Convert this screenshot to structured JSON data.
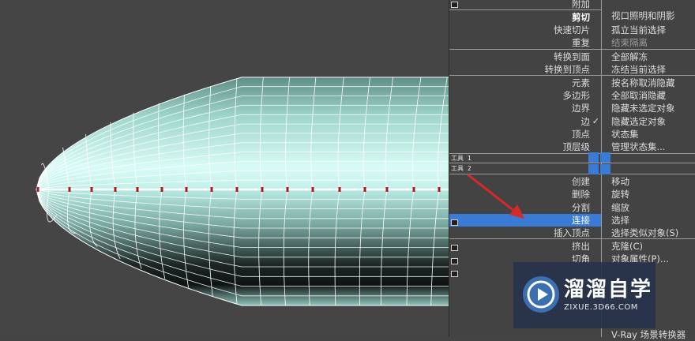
{
  "left_menu": {
    "items": [
      {
        "label": "附加",
        "style": "normal"
      },
      {
        "label": "剪切",
        "style": "bold"
      },
      {
        "label": "快速切片",
        "style": "normal"
      },
      {
        "label": "重复",
        "style": "normal"
      },
      {
        "label": "转换到面",
        "style": "normal"
      },
      {
        "label": "转换到顶点",
        "style": "normal"
      },
      {
        "label": "元素",
        "style": "normal"
      },
      {
        "label": "多边形",
        "style": "normal"
      },
      {
        "label": "边界",
        "style": "normal"
      },
      {
        "label": "边",
        "style": "normal",
        "checked": true
      },
      {
        "label": "顶点",
        "style": "normal"
      },
      {
        "label": "顶层级",
        "style": "normal"
      },
      {
        "label": "创建",
        "style": "normal"
      },
      {
        "label": "删除",
        "style": "normal"
      },
      {
        "label": "分割",
        "style": "normal"
      },
      {
        "label": "连接",
        "style": "highlight"
      },
      {
        "label": "插入顶点",
        "style": "normal"
      },
      {
        "label": "挤出",
        "style": "normal"
      },
      {
        "label": "切角",
        "style": "normal"
      }
    ]
  },
  "right_menu": {
    "items": [
      {
        "label": "视口照明和阴影",
        "style": "normal"
      },
      {
        "label": "孤立当前选择",
        "style": "normal"
      },
      {
        "label": "结束隔离",
        "style": "dim"
      },
      {
        "label": "全部解冻",
        "style": "normal"
      },
      {
        "label": "冻结当前选择",
        "style": "normal"
      },
      {
        "label": "按名称取消隐藏",
        "style": "normal"
      },
      {
        "label": "全部取消隐藏",
        "style": "normal"
      },
      {
        "label": "隐藏未选定对象",
        "style": "normal"
      },
      {
        "label": "隐藏选定对象",
        "style": "normal"
      },
      {
        "label": "状态集",
        "style": "normal"
      },
      {
        "label": "管理状态集...",
        "style": "normal"
      },
      {
        "label": "移动",
        "style": "normal"
      },
      {
        "label": "旋转",
        "style": "normal"
      },
      {
        "label": "缩放",
        "style": "normal"
      },
      {
        "label": "选择",
        "style": "normal"
      },
      {
        "label": "选择类似对象(S)",
        "style": "normal"
      },
      {
        "label": "克隆(C)",
        "style": "normal"
      },
      {
        "label": "对象属性(P)...",
        "style": "normal"
      },
      {
        "label": "V-Ray 场景转换器",
        "style": "normal"
      }
    ]
  },
  "quad_headers": {
    "tools1": "工具 1",
    "tools2": "工具 2"
  },
  "icons": {
    "check": "✓"
  },
  "watermark": {
    "title": "溜溜自学",
    "url": "ZIXUE.3D66.COM"
  },
  "colors": {
    "highlight": "#3a7bd5",
    "mesh_face": "#a8e6da",
    "arrow": "#d42a2a"
  }
}
